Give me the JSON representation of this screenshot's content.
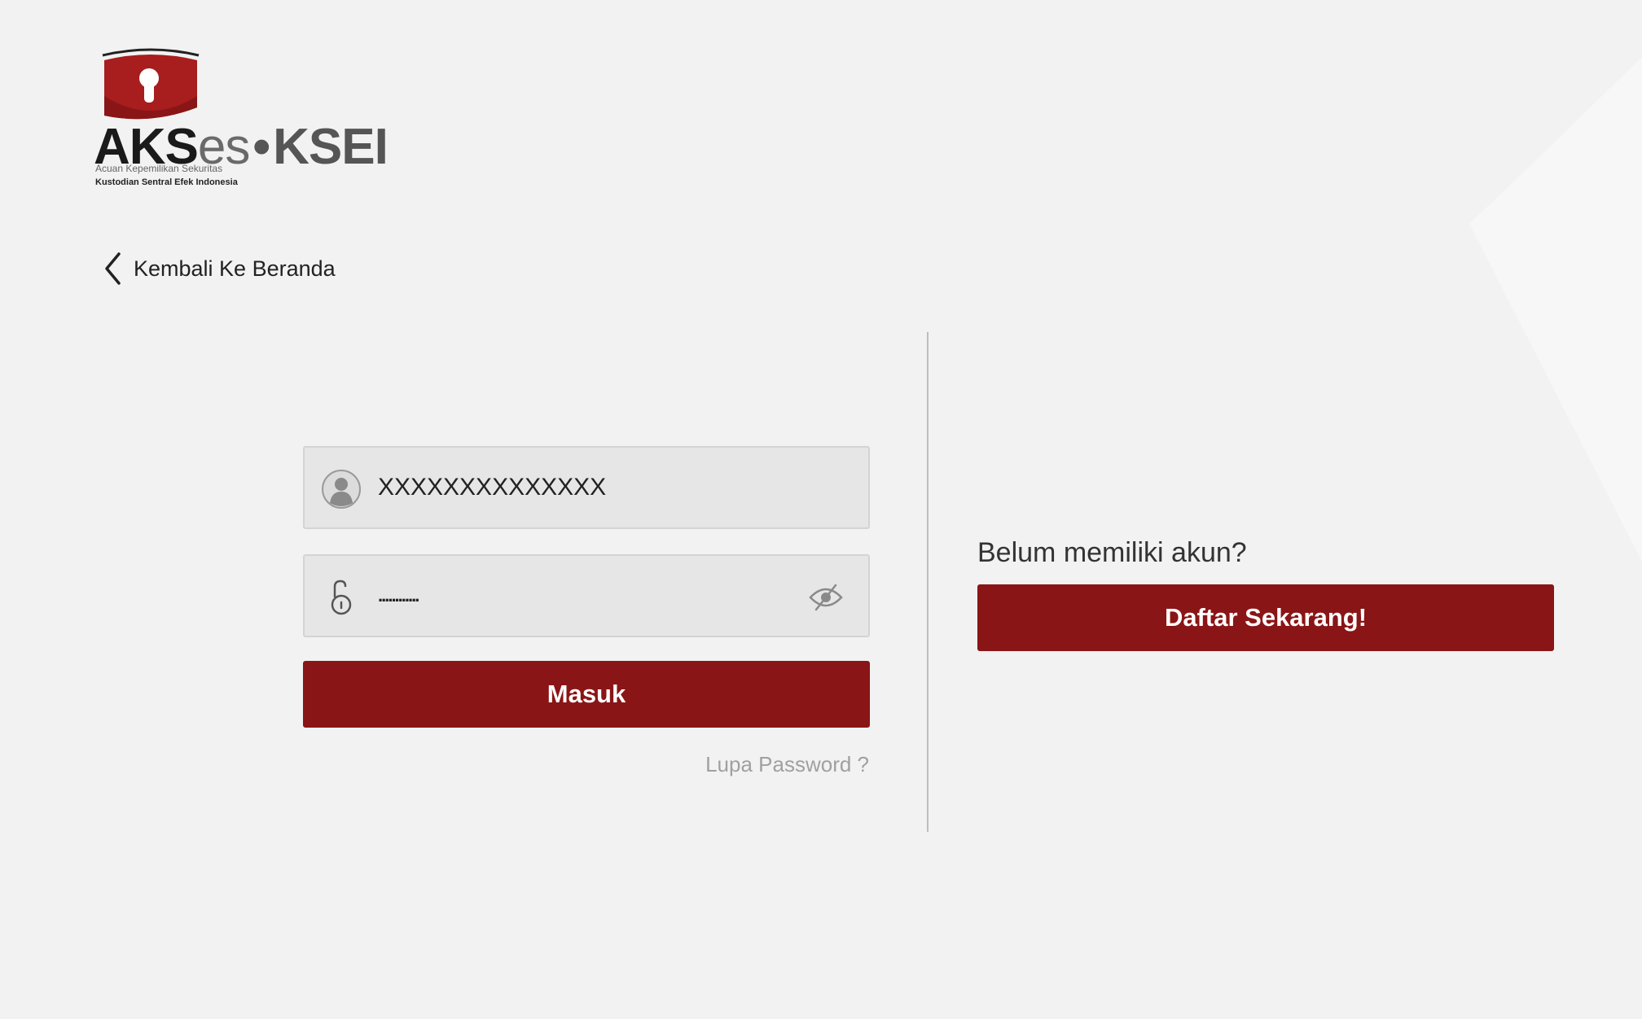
{
  "logo": {
    "word_part1": "AKS",
    "word_part2": "es",
    "word_dot": "•",
    "word_part3": "KSEI",
    "subtitle": "Acuan Kepemilikan Sekuritas",
    "org_name": "Kustodian Sentral Efek Indonesia"
  },
  "nav": {
    "back_label": "Kembali Ke Beranda"
  },
  "login": {
    "username_value": "XXXXXXXXXXXXXX",
    "password_value": "............",
    "submit_label": "Masuk",
    "forgot_label": "Lupa Password ?"
  },
  "register": {
    "question": "Belum memiliki akun?",
    "button_label": "Daftar Sekarang!"
  },
  "icons": {
    "back": "chevron-left-icon",
    "user": "user-icon",
    "lock": "lock-open-icon",
    "eye": "eye-slash-icon"
  },
  "colors": {
    "accent": "#8a1516",
    "background": "#f2f2f2",
    "field_bg": "#e6e6e6",
    "muted_text": "#a0a0a0"
  }
}
